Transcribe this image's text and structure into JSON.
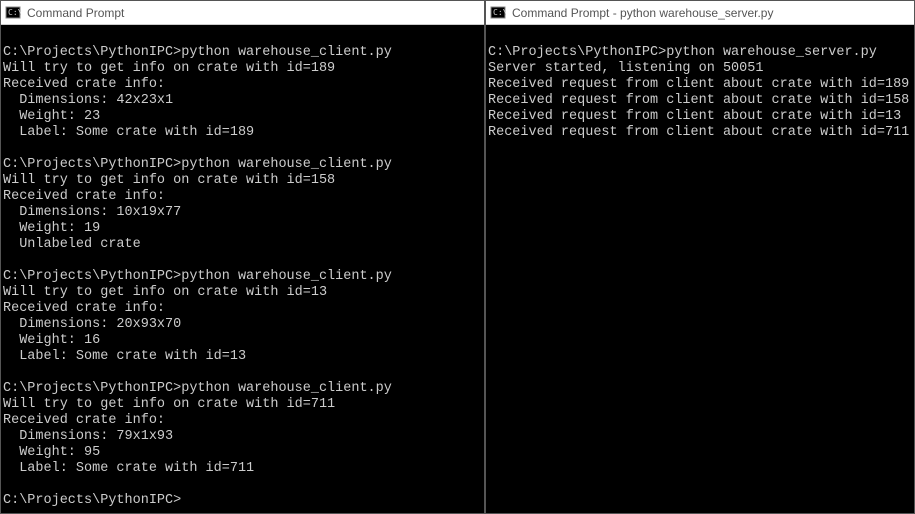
{
  "left_window": {
    "title": "Command Prompt",
    "prompt": "C:\\Projects\\PythonIPC>",
    "command": "python warehouse_client.py",
    "runs": [
      {
        "id": "189",
        "lines": [
          "Will try to get info on crate with id=189",
          "Received crate info:",
          "  Dimensions: 42x23x1",
          "  Weight: 23",
          "  Label: Some crate with id=189"
        ]
      },
      {
        "id": "158",
        "lines": [
          "Will try to get info on crate with id=158",
          "Received crate info:",
          "  Dimensions: 10x19x77",
          "  Weight: 19",
          "  Unlabeled crate"
        ]
      },
      {
        "id": "13",
        "lines": [
          "Will try to get info on crate with id=13",
          "Received crate info:",
          "  Dimensions: 20x93x70",
          "  Weight: 16",
          "  Label: Some crate with id=13"
        ]
      },
      {
        "id": "711",
        "lines": [
          "Will try to get info on crate with id=711",
          "Received crate info:",
          "  Dimensions: 79x1x93",
          "  Weight: 95",
          "  Label: Some crate with id=711"
        ]
      }
    ],
    "final_prompt": "C:\\Projects\\PythonIPC>"
  },
  "right_window": {
    "title": "Command Prompt - python  warehouse_server.py",
    "prompt": "C:\\Projects\\PythonIPC>",
    "command": "python warehouse_server.py",
    "lines": [
      "Server started, listening on 50051",
      "Received request from client about crate with id=189",
      "Received request from client about crate with id=158",
      "Received request from client about crate with id=13",
      "Received request from client about crate with id=711"
    ]
  }
}
